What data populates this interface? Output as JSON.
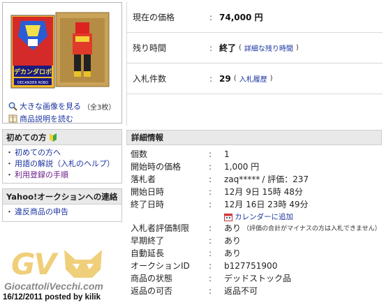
{
  "left": {
    "image_links": {
      "larger": "大きな画像を見る",
      "larger_count": "（全3枚）",
      "description": "商品説明を読む"
    },
    "beginners_panel": {
      "title": "初めての方",
      "items": [
        {
          "label": "初めての方へ"
        },
        {
          "label": "用語の解説（入札のヘルプ）"
        },
        {
          "label": "利用登録の手順"
        }
      ]
    },
    "contact_panel": {
      "title": "Yahoo!オークションへの連絡",
      "items": [
        {
          "label": "違反商品の申告"
        }
      ]
    },
    "product_image_text": {
      "title": "デカンダロボ",
      "subtitle": "DECANDER ROBO"
    }
  },
  "summary": {
    "price_label": "現在の価格",
    "price_value": "74,000 円",
    "remaining_label": "残り時間",
    "remaining_value": "終了",
    "remaining_link": "詳細な残り時間",
    "bids_label": "入札件数",
    "bids_value": "29",
    "bids_link": "入札履歴"
  },
  "details": {
    "title": "詳細情報",
    "rows": [
      {
        "label": "個数",
        "value": "1"
      },
      {
        "label": "開始時の価格",
        "value": "1,000 円"
      },
      {
        "label": "落札者",
        "value": "zaq*****",
        "extra": "/ 評価：237"
      },
      {
        "label": "開始日時",
        "value": "12月 9日 15時 48分"
      },
      {
        "label": "終了日時",
        "value": "12月 16日 23時 49分"
      },
      {
        "label": "入札者評価制限",
        "value": "あり",
        "extra": "（評価の合計がマイナスの方は入札できません）"
      },
      {
        "label": "早期終了",
        "value": "あり"
      },
      {
        "label": "自動延長",
        "value": "あり"
      },
      {
        "label": "オークションID",
        "value": "b127751900"
      },
      {
        "label": "商品の状態",
        "value": "デッドストック品"
      },
      {
        "label": "返品の可否",
        "value": "返品不可"
      }
    ],
    "calendar_link": "カレンダーに追加"
  },
  "watermark": {
    "logo": "GV",
    "site": "GiocattoliVecchi.com",
    "posted": "16/12/2011 posted by kilik"
  },
  "colors": {
    "link": "#1a33a0",
    "panel_header": "#e9e9e9",
    "watermark_gold": "#f0cf7a"
  }
}
